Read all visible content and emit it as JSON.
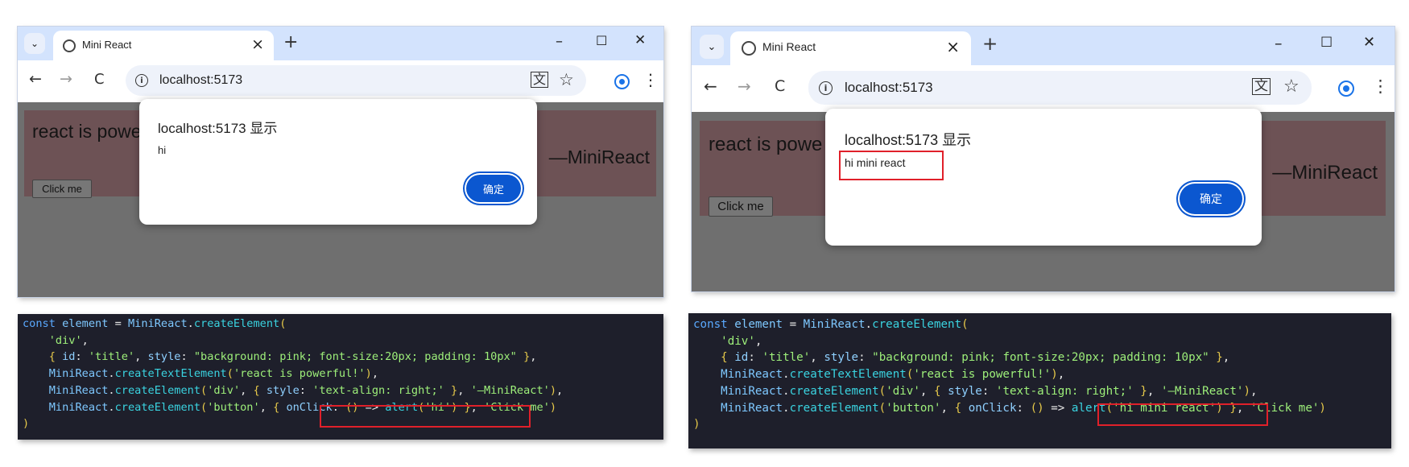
{
  "left": {
    "browser": {
      "tab_title": "Mini React",
      "close_label": "×",
      "new_tab_label": "+",
      "minimize_label": "–",
      "maximize_label": "☐",
      "window_close_label": "✕",
      "back_label": "←",
      "forward_label": "→",
      "reload_label": "C",
      "info_label": "i",
      "url": "localhost:5173",
      "translate_label": "文",
      "star_label": "☆",
      "menu_label": "⋮"
    },
    "page": {
      "text": "react is powe",
      "author": "—MiniReact",
      "button_label": "Click me"
    },
    "dialog": {
      "title": "localhost:5173 显示",
      "message": "hi",
      "ok_label": "确定"
    },
    "code_lines": [
      [
        [
          "kw",
          "const "
        ],
        [
          "var",
          "element"
        ],
        [
          "pun",
          " = "
        ],
        [
          "var",
          "MiniReact"
        ],
        [
          "pun",
          "."
        ],
        [
          "fn",
          "createElement"
        ],
        [
          "br",
          "("
        ]
      ],
      [
        [
          "pun",
          "    "
        ],
        [
          "str",
          "'div'"
        ],
        [
          "pun",
          ","
        ]
      ],
      [
        [
          "pun",
          "    "
        ],
        [
          "br",
          "{ "
        ],
        [
          "key",
          "id"
        ],
        [
          "pun",
          ": "
        ],
        [
          "str",
          "'title'"
        ],
        [
          "pun",
          ", "
        ],
        [
          "key",
          "style"
        ],
        [
          "pun",
          ": "
        ],
        [
          "str",
          "\"background: pink; font-size:20px; padding: 10px\""
        ],
        [
          "pun",
          " "
        ],
        [
          "br",
          "}"
        ],
        [
          "pun",
          ","
        ]
      ],
      [
        [
          "pun",
          "    "
        ],
        [
          "var",
          "MiniReact"
        ],
        [
          "pun",
          "."
        ],
        [
          "fn",
          "createTextElement"
        ],
        [
          "br",
          "("
        ],
        [
          "str",
          "'react is powerful!'"
        ],
        [
          "br",
          ")"
        ],
        [
          "pun",
          ","
        ]
      ],
      [
        [
          "pun",
          "    "
        ],
        [
          "var",
          "MiniReact"
        ],
        [
          "pun",
          "."
        ],
        [
          "fn",
          "createElement"
        ],
        [
          "br",
          "("
        ],
        [
          "str",
          "'div'"
        ],
        [
          "pun",
          ", "
        ],
        [
          "br",
          "{ "
        ],
        [
          "key",
          "style"
        ],
        [
          "pun",
          ": "
        ],
        [
          "str",
          "'text-align: right;'"
        ],
        [
          "pun",
          " "
        ],
        [
          "br",
          "}"
        ],
        [
          "pun",
          ", "
        ],
        [
          "str",
          "'—MiniReact'"
        ],
        [
          "br",
          ")"
        ],
        [
          "pun",
          ","
        ]
      ],
      [
        [
          "pun",
          "    "
        ],
        [
          "var",
          "MiniReact"
        ],
        [
          "pun",
          "."
        ],
        [
          "fn",
          "createElement"
        ],
        [
          "br",
          "("
        ],
        [
          "str",
          "'button'"
        ],
        [
          "pun",
          ", "
        ],
        [
          "br",
          "{ "
        ],
        [
          "key",
          "onClick"
        ],
        [
          "pun",
          ": "
        ],
        [
          "br",
          "() "
        ],
        [
          "pun",
          "=> "
        ],
        [
          "fn",
          "alert"
        ],
        [
          "br",
          "("
        ],
        [
          "str",
          "'hi'"
        ],
        [
          "br",
          ")"
        ],
        [
          "pun",
          " "
        ],
        [
          "br",
          "}"
        ],
        [
          "pun",
          ", "
        ],
        [
          "str",
          "'Click me'"
        ],
        [
          "br",
          ")"
        ]
      ],
      [
        [
          "br",
          ")"
        ]
      ]
    ]
  },
  "right": {
    "browser": {
      "tab_title": "Mini React",
      "close_label": "×",
      "new_tab_label": "+",
      "minimize_label": "–",
      "maximize_label": "☐",
      "window_close_label": "✕",
      "back_label": "←",
      "forward_label": "→",
      "reload_label": "C",
      "info_label": "i",
      "url": "localhost:5173",
      "translate_label": "文",
      "star_label": "☆",
      "menu_label": "⋮"
    },
    "page": {
      "text": "react is powe",
      "author": "—MiniReact",
      "button_label": "Click me"
    },
    "dialog": {
      "title": "localhost:5173 显示",
      "message": "hi mini react",
      "ok_label": "确定"
    },
    "code_lines": [
      [
        [
          "kw",
          "const "
        ],
        [
          "var",
          "element"
        ],
        [
          "pun",
          " = "
        ],
        [
          "var",
          "MiniReact"
        ],
        [
          "pun",
          "."
        ],
        [
          "fn",
          "createElement"
        ],
        [
          "br",
          "("
        ]
      ],
      [
        [
          "pun",
          "    "
        ],
        [
          "str",
          "'div'"
        ],
        [
          "pun",
          ","
        ]
      ],
      [
        [
          "pun",
          "    "
        ],
        [
          "br",
          "{ "
        ],
        [
          "key",
          "id"
        ],
        [
          "pun",
          ": "
        ],
        [
          "str",
          "'title'"
        ],
        [
          "pun",
          ", "
        ],
        [
          "key",
          "style"
        ],
        [
          "pun",
          ": "
        ],
        [
          "str",
          "\"background: pink; font-size:20px; padding: 10px\""
        ],
        [
          "pun",
          " "
        ],
        [
          "br",
          "}"
        ],
        [
          "pun",
          ","
        ]
      ],
      [
        [
          "pun",
          "    "
        ],
        [
          "var",
          "MiniReact"
        ],
        [
          "pun",
          "."
        ],
        [
          "fn",
          "createTextElement"
        ],
        [
          "br",
          "("
        ],
        [
          "str",
          "'react is powerful!'"
        ],
        [
          "br",
          ")"
        ],
        [
          "pun",
          ","
        ]
      ],
      [
        [
          "pun",
          "    "
        ],
        [
          "var",
          "MiniReact"
        ],
        [
          "pun",
          "."
        ],
        [
          "fn",
          "createElement"
        ],
        [
          "br",
          "("
        ],
        [
          "str",
          "'div'"
        ],
        [
          "pun",
          ", "
        ],
        [
          "br",
          "{ "
        ],
        [
          "key",
          "style"
        ],
        [
          "pun",
          ": "
        ],
        [
          "str",
          "'text-align: right;'"
        ],
        [
          "pun",
          " "
        ],
        [
          "br",
          "}"
        ],
        [
          "pun",
          ", "
        ],
        [
          "str",
          "'—MiniReact'"
        ],
        [
          "br",
          ")"
        ],
        [
          "pun",
          ","
        ]
      ],
      [
        [
          "pun",
          "    "
        ],
        [
          "var",
          "MiniReact"
        ],
        [
          "pun",
          "."
        ],
        [
          "fn",
          "createElement"
        ],
        [
          "br",
          "("
        ],
        [
          "str",
          "'button'"
        ],
        [
          "pun",
          ", "
        ],
        [
          "br",
          "{ "
        ],
        [
          "key",
          "onClick"
        ],
        [
          "pun",
          ": "
        ],
        [
          "br",
          "() "
        ],
        [
          "pun",
          "=> "
        ],
        [
          "fn",
          "alert"
        ],
        [
          "br",
          "("
        ],
        [
          "str",
          "'hi mini react'"
        ],
        [
          "br",
          ")"
        ],
        [
          "pun",
          " "
        ],
        [
          "br",
          "}"
        ],
        [
          "pun",
          ", "
        ],
        [
          "str",
          "'Click me'"
        ],
        [
          "br",
          ")"
        ]
      ],
      [
        [
          "br",
          ")"
        ]
      ]
    ]
  }
}
